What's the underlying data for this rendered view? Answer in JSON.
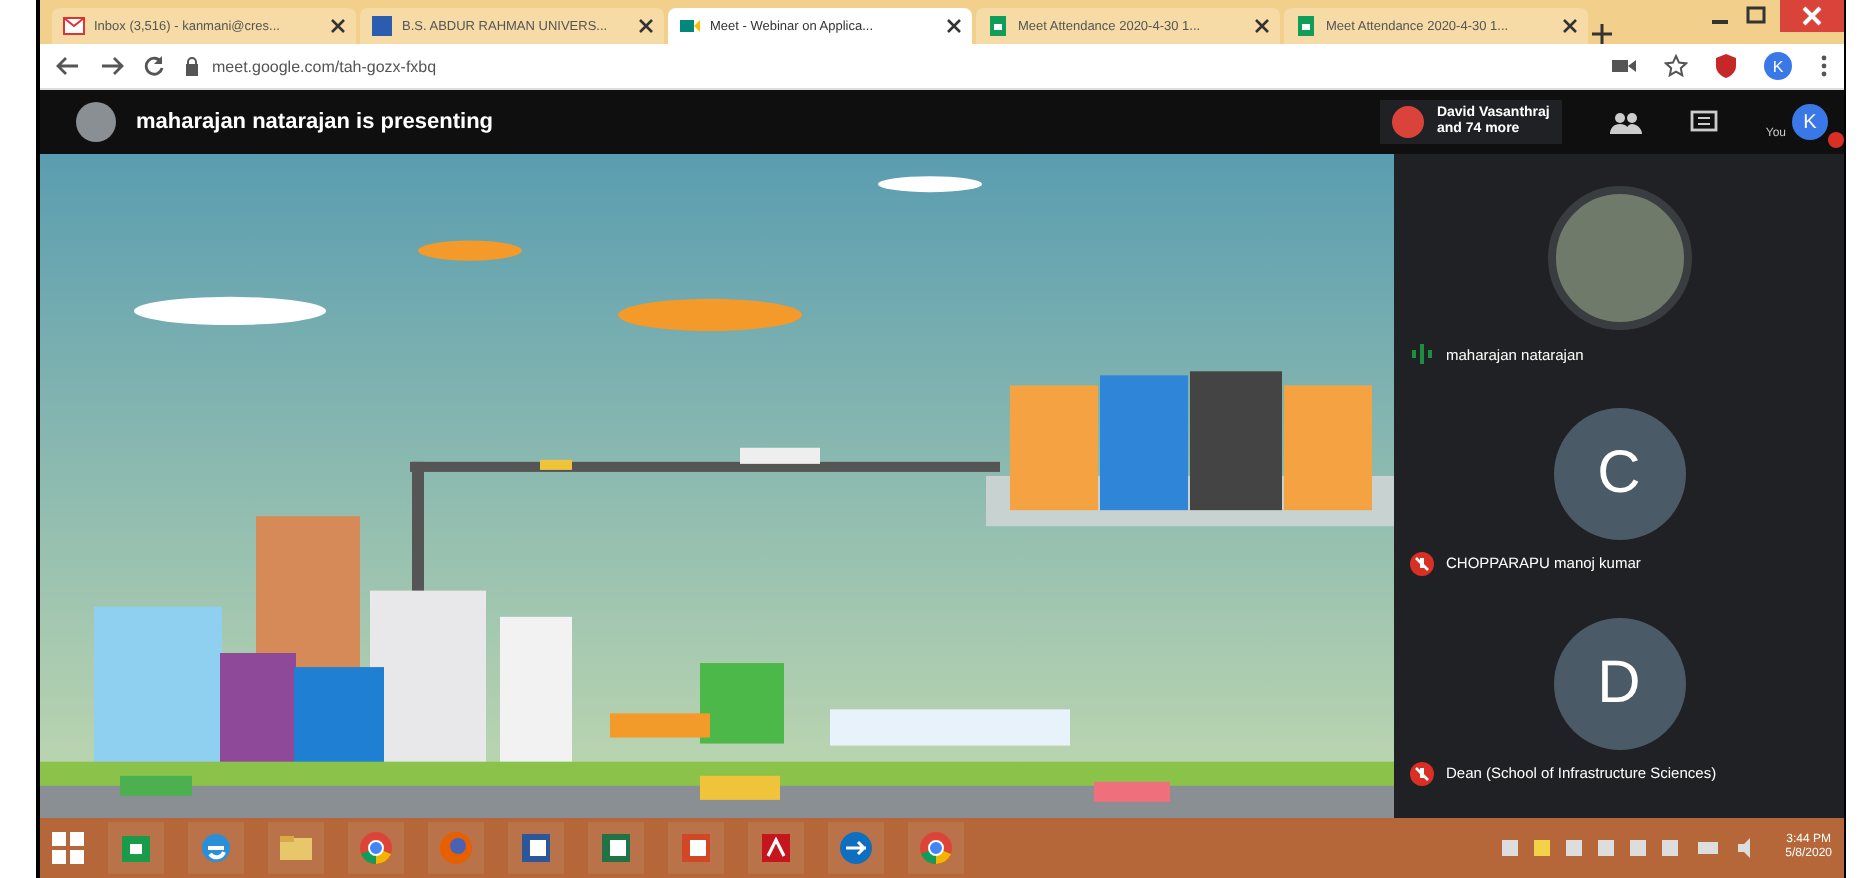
{
  "browser": {
    "tabs": [
      {
        "title": "Inbox (3,516) - kanmani@cres...",
        "kind": "mail",
        "selected": false
      },
      {
        "title": "B.S. ABDUR RAHMAN UNIVERS...",
        "kind": "site",
        "selected": false
      },
      {
        "title": "Meet - Webinar on Applica...",
        "kind": "meet",
        "selected": true
      },
      {
        "title": "Meet Attendance 2020-4-30 1...",
        "kind": "sheet",
        "selected": false
      },
      {
        "title": "Meet Attendance 2020-4-30 1...",
        "kind": "sheet",
        "selected": false
      }
    ],
    "url": "meet.google.com/tah-gozx-fxbq",
    "profile_initial": "K"
  },
  "meet": {
    "presenting": "maharajan natarajan is presenting",
    "participants_summary": "David Vasanthraj\nand 74 more",
    "self_label": "You",
    "self_initial": "K"
  },
  "participants": [
    {
      "name": "maharajan natarajan",
      "kind": "photo",
      "muted": false
    },
    {
      "name": "CHOPPARAPU manoj kumar",
      "kind": "letter",
      "initial": "C",
      "muted": true
    },
    {
      "name": "Dean (School of Infrastructure Sciences)",
      "kind": "letter",
      "initial": "D",
      "muted": true
    }
  ],
  "taskbar": {
    "apps": [
      {
        "kind": "store"
      },
      {
        "kind": "ie"
      },
      {
        "kind": "explorer"
      },
      {
        "kind": "chrome"
      },
      {
        "kind": "firefox"
      },
      {
        "kind": "word"
      },
      {
        "kind": "excel"
      },
      {
        "kind": "powerpoint"
      },
      {
        "kind": "acrobat"
      },
      {
        "kind": "teamviewer"
      },
      {
        "kind": "chrome"
      }
    ],
    "time": "3:44 PM",
    "date": "5/8/2020"
  }
}
